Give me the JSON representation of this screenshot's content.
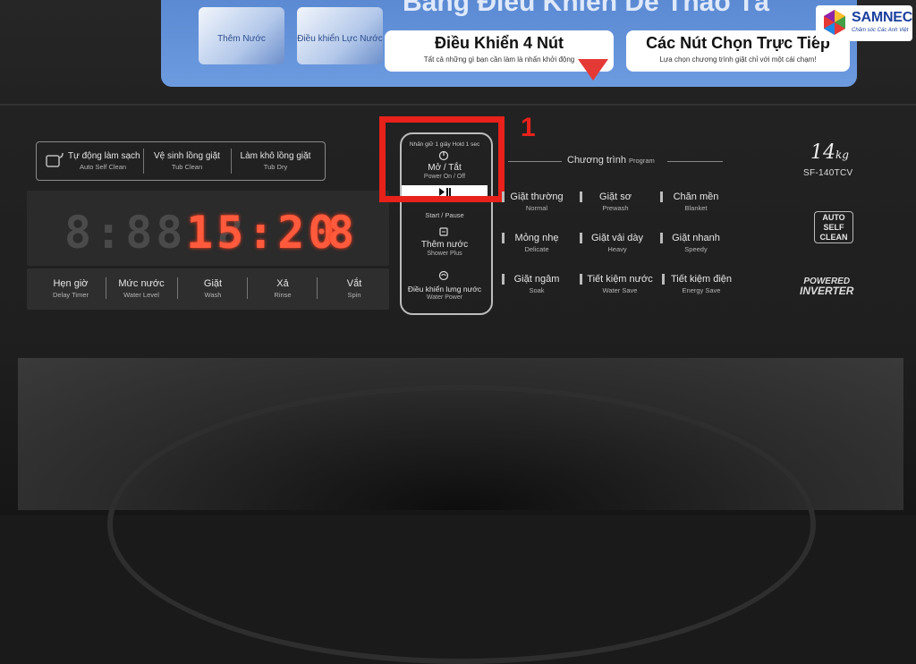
{
  "banner": {
    "title": "Bảng Điều Khiển Dễ Thao Tá",
    "thumb1_label": "Thêm Nước",
    "thumb2_label": "Điều khiển Lực Nước",
    "card1_title": "Điều Khiển 4 Nút",
    "card1_sub": "Tất cả những gì bạn cần làm là nhấn khởi động",
    "card2_title": "Các Nút Chọn Trực Tiếp",
    "card2_sub": "Lựa chọn chương trình giặt chỉ với một cái chạm!"
  },
  "logo": {
    "name": "SAMNEC",
    "tagline": "Chăm sóc Các Anh Việt"
  },
  "clean_buttons": [
    {
      "vn": "Tự động làm sạch",
      "en": "Auto Self Clean"
    },
    {
      "vn": "Vệ sinh lồng giặt",
      "en": "Tub Clean"
    },
    {
      "vn": "Làm khô lồng giặt",
      "en": "Tub Dry"
    }
  ],
  "display": {
    "dim_digits": "8:88  8",
    "time": "15:20",
    "bright_digit": "8"
  },
  "bottom_buttons": [
    {
      "vn": "Hẹn giờ",
      "en": "Delay Timer"
    },
    {
      "vn": "Mức nước",
      "en": "Water Level"
    },
    {
      "vn": "Giặt",
      "en": "Wash"
    },
    {
      "vn": "Xả",
      "en": "Rinse"
    },
    {
      "vn": "Vắt",
      "en": "Spin"
    }
  ],
  "center": {
    "hold_label": "Nhấn giữ 1 giây Hold 1 sec",
    "power_vn": "Mở / Tắt",
    "power_en": "Power On / Off",
    "start_en": "Start / Pause",
    "shower_vn": "Thêm nước",
    "shower_en": "Shower Plus",
    "waterpower_vn": "Điều khiển lưng nước",
    "waterpower_en": "Water Power"
  },
  "highlight_number": "1",
  "program": {
    "title_vn": "Chương trình",
    "title_en": "Program",
    "items": [
      {
        "vn": "Giặt thường",
        "en": "Normal"
      },
      {
        "vn": "Giặt sơ",
        "en": "Prewash"
      },
      {
        "vn": "Chăn mền",
        "en": "Blanket"
      },
      {
        "vn": "Mỏng nhẹ",
        "en": "Delicate"
      },
      {
        "vn": "Giặt vải dày",
        "en": "Heavy"
      },
      {
        "vn": "Giặt nhanh",
        "en": "Speedy"
      },
      {
        "vn": "Giặt ngâm",
        "en": "Soak"
      },
      {
        "vn": "Tiết kiệm nước",
        "en": "Water Save"
      },
      {
        "vn": "Tiết kiệm điện",
        "en": "Energy Save"
      }
    ]
  },
  "brand": {
    "capacity": "14",
    "unit": "kg",
    "model": "SF-140TCV",
    "autoclean": [
      "AUTO",
      "SELF",
      "CLEAN"
    ],
    "inverter_top": "POWERED",
    "inverter_bottom": "INVERTER"
  },
  "colors": {
    "highlight": "#e8211b",
    "display_lit": "#ff5a3c",
    "display_dim": "#4a4a4a"
  }
}
